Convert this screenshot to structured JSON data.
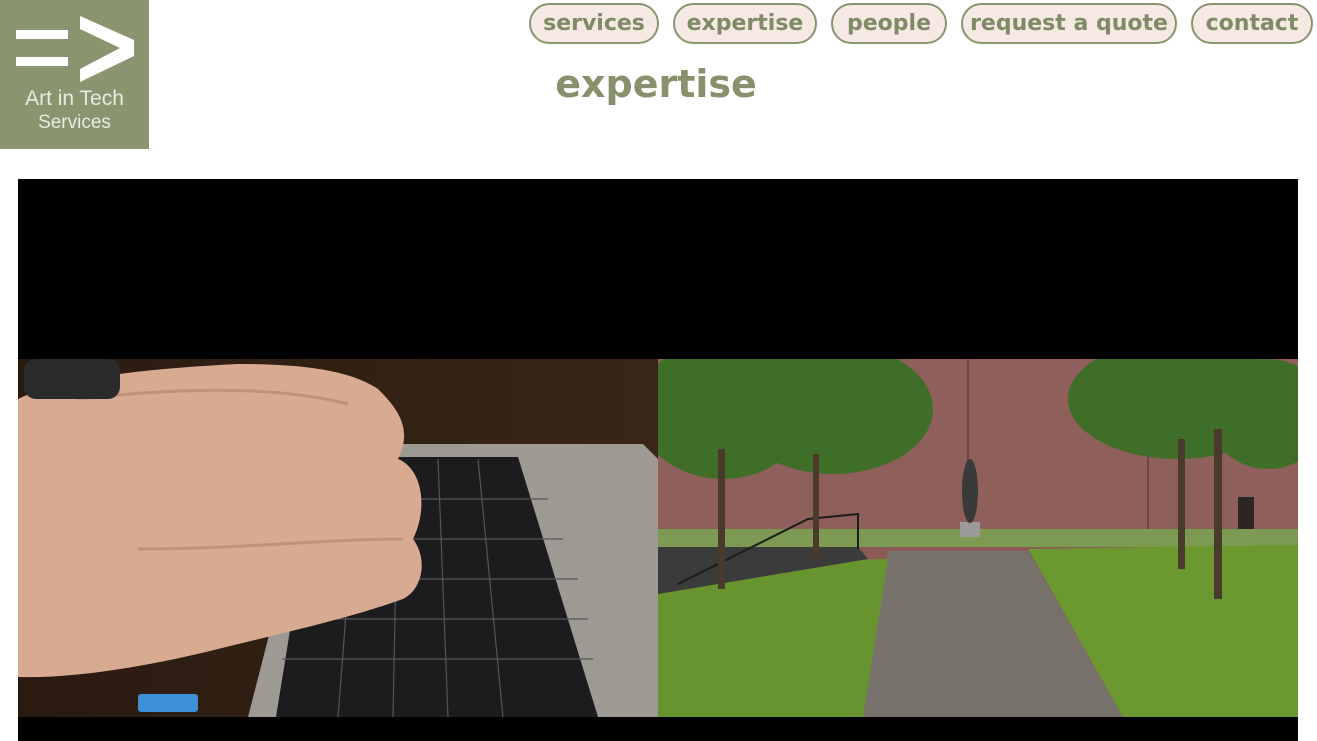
{
  "logo": {
    "mark": "=>",
    "line1": "Art in Tech",
    "line2": "Services"
  },
  "nav": {
    "services": "services",
    "expertise": "expertise",
    "people": "people",
    "quote": "request a quote",
    "contact": "contact"
  },
  "page_title": "expertise",
  "colors": {
    "brand": "#8a9570",
    "nav_bg": "#f6e9e3",
    "video_bg": "#000000"
  },
  "video": {
    "left_scene": "hands typing on a laptop keyboard",
    "right_scene": "courtyard path with trees and a sculpture in front of a brick wall"
  }
}
